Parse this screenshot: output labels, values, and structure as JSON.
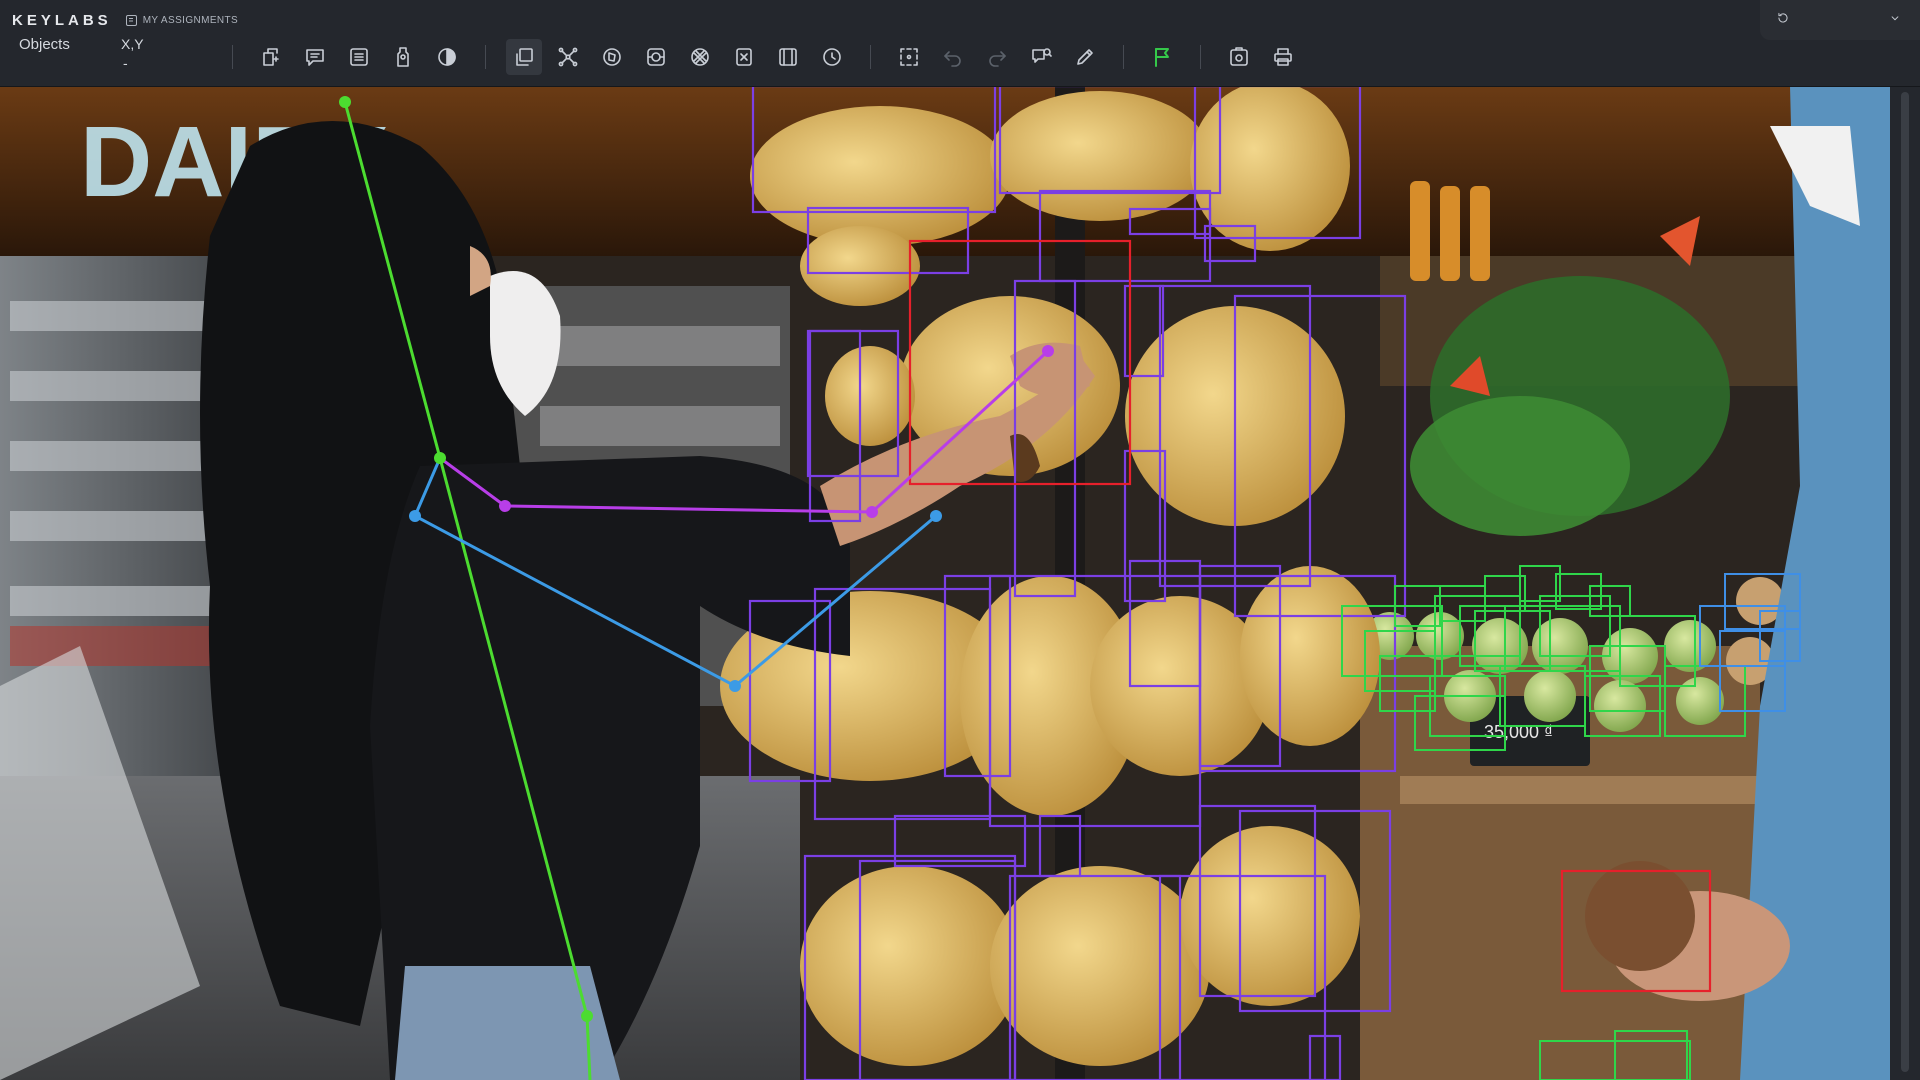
{
  "app": {
    "brand": "KEYLABS",
    "assignments_label": "MY ASSIGNMENTS"
  },
  "info": {
    "objects_label": "Objects",
    "xy_label": "X,Y",
    "xy_value": "-"
  },
  "toolbar": {
    "groups": [
      [
        "new-object-icon",
        "comment-icon",
        "list-icon",
        "tag-icon",
        "contrast-icon"
      ],
      [
        "copy-icon",
        "skeleton-icon",
        "polygon-icon",
        "semantic-icon",
        "mask-icon",
        "erase-icon",
        "grid-icon",
        "timer-icon"
      ],
      [
        "select-icon",
        "undo-icon",
        "redo-icon",
        "review-icon",
        "edit-icon"
      ],
      [
        "flag-icon"
      ],
      [
        "snapshot-icon",
        "print-icon"
      ]
    ],
    "active": "copy-icon",
    "disabled": [
      "undo-icon",
      "redo-icon"
    ],
    "flag_color": "#35c84a"
  },
  "top_right": {
    "icons": [
      "history-icon",
      "chevron-down-icon"
    ]
  },
  "scene": {
    "store_sign": "DAIRY",
    "price_tag": "35,000 ₫",
    "annotation_colors": {
      "banana": "#7b3fe4",
      "selected": "#e6202b",
      "green_fruit": "#2fd64a",
      "blue_fruit": "#3f8fe6",
      "skeleton_spine": "#4cdc30",
      "skeleton_right_arm": "#b83ee8",
      "skeleton_left_arm": "#3c9be6"
    }
  }
}
